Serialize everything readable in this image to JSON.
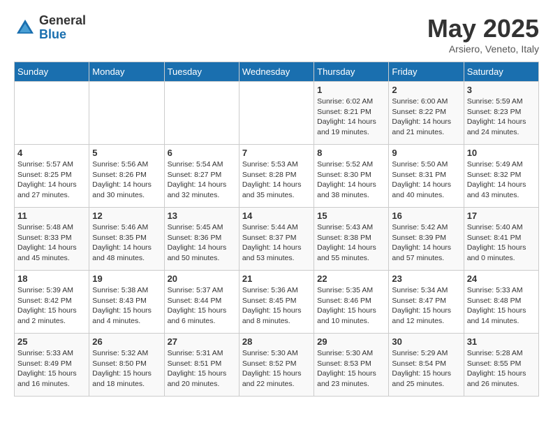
{
  "header": {
    "logo_general": "General",
    "logo_blue": "Blue",
    "month_title": "May 2025",
    "location": "Arsiero, Veneto, Italy"
  },
  "days_of_week": [
    "Sunday",
    "Monday",
    "Tuesday",
    "Wednesday",
    "Thursday",
    "Friday",
    "Saturday"
  ],
  "weeks": [
    [
      {
        "day": "",
        "info": ""
      },
      {
        "day": "",
        "info": ""
      },
      {
        "day": "",
        "info": ""
      },
      {
        "day": "",
        "info": ""
      },
      {
        "day": "1",
        "info": "Sunrise: 6:02 AM\nSunset: 8:21 PM\nDaylight: 14 hours\nand 19 minutes."
      },
      {
        "day": "2",
        "info": "Sunrise: 6:00 AM\nSunset: 8:22 PM\nDaylight: 14 hours\nand 21 minutes."
      },
      {
        "day": "3",
        "info": "Sunrise: 5:59 AM\nSunset: 8:23 PM\nDaylight: 14 hours\nand 24 minutes."
      }
    ],
    [
      {
        "day": "4",
        "info": "Sunrise: 5:57 AM\nSunset: 8:25 PM\nDaylight: 14 hours\nand 27 minutes."
      },
      {
        "day": "5",
        "info": "Sunrise: 5:56 AM\nSunset: 8:26 PM\nDaylight: 14 hours\nand 30 minutes."
      },
      {
        "day": "6",
        "info": "Sunrise: 5:54 AM\nSunset: 8:27 PM\nDaylight: 14 hours\nand 32 minutes."
      },
      {
        "day": "7",
        "info": "Sunrise: 5:53 AM\nSunset: 8:28 PM\nDaylight: 14 hours\nand 35 minutes."
      },
      {
        "day": "8",
        "info": "Sunrise: 5:52 AM\nSunset: 8:30 PM\nDaylight: 14 hours\nand 38 minutes."
      },
      {
        "day": "9",
        "info": "Sunrise: 5:50 AM\nSunset: 8:31 PM\nDaylight: 14 hours\nand 40 minutes."
      },
      {
        "day": "10",
        "info": "Sunrise: 5:49 AM\nSunset: 8:32 PM\nDaylight: 14 hours\nand 43 minutes."
      }
    ],
    [
      {
        "day": "11",
        "info": "Sunrise: 5:48 AM\nSunset: 8:33 PM\nDaylight: 14 hours\nand 45 minutes."
      },
      {
        "day": "12",
        "info": "Sunrise: 5:46 AM\nSunset: 8:35 PM\nDaylight: 14 hours\nand 48 minutes."
      },
      {
        "day": "13",
        "info": "Sunrise: 5:45 AM\nSunset: 8:36 PM\nDaylight: 14 hours\nand 50 minutes."
      },
      {
        "day": "14",
        "info": "Sunrise: 5:44 AM\nSunset: 8:37 PM\nDaylight: 14 hours\nand 53 minutes."
      },
      {
        "day": "15",
        "info": "Sunrise: 5:43 AM\nSunset: 8:38 PM\nDaylight: 14 hours\nand 55 minutes."
      },
      {
        "day": "16",
        "info": "Sunrise: 5:42 AM\nSunset: 8:39 PM\nDaylight: 14 hours\nand 57 minutes."
      },
      {
        "day": "17",
        "info": "Sunrise: 5:40 AM\nSunset: 8:41 PM\nDaylight: 15 hours\nand 0 minutes."
      }
    ],
    [
      {
        "day": "18",
        "info": "Sunrise: 5:39 AM\nSunset: 8:42 PM\nDaylight: 15 hours\nand 2 minutes."
      },
      {
        "day": "19",
        "info": "Sunrise: 5:38 AM\nSunset: 8:43 PM\nDaylight: 15 hours\nand 4 minutes."
      },
      {
        "day": "20",
        "info": "Sunrise: 5:37 AM\nSunset: 8:44 PM\nDaylight: 15 hours\nand 6 minutes."
      },
      {
        "day": "21",
        "info": "Sunrise: 5:36 AM\nSunset: 8:45 PM\nDaylight: 15 hours\nand 8 minutes."
      },
      {
        "day": "22",
        "info": "Sunrise: 5:35 AM\nSunset: 8:46 PM\nDaylight: 15 hours\nand 10 minutes."
      },
      {
        "day": "23",
        "info": "Sunrise: 5:34 AM\nSunset: 8:47 PM\nDaylight: 15 hours\nand 12 minutes."
      },
      {
        "day": "24",
        "info": "Sunrise: 5:33 AM\nSunset: 8:48 PM\nDaylight: 15 hours\nand 14 minutes."
      }
    ],
    [
      {
        "day": "25",
        "info": "Sunrise: 5:33 AM\nSunset: 8:49 PM\nDaylight: 15 hours\nand 16 minutes."
      },
      {
        "day": "26",
        "info": "Sunrise: 5:32 AM\nSunset: 8:50 PM\nDaylight: 15 hours\nand 18 minutes."
      },
      {
        "day": "27",
        "info": "Sunrise: 5:31 AM\nSunset: 8:51 PM\nDaylight: 15 hours\nand 20 minutes."
      },
      {
        "day": "28",
        "info": "Sunrise: 5:30 AM\nSunset: 8:52 PM\nDaylight: 15 hours\nand 22 minutes."
      },
      {
        "day": "29",
        "info": "Sunrise: 5:30 AM\nSunset: 8:53 PM\nDaylight: 15 hours\nand 23 minutes."
      },
      {
        "day": "30",
        "info": "Sunrise: 5:29 AM\nSunset: 8:54 PM\nDaylight: 15 hours\nand 25 minutes."
      },
      {
        "day": "31",
        "info": "Sunrise: 5:28 AM\nSunset: 8:55 PM\nDaylight: 15 hours\nand 26 minutes."
      }
    ]
  ]
}
